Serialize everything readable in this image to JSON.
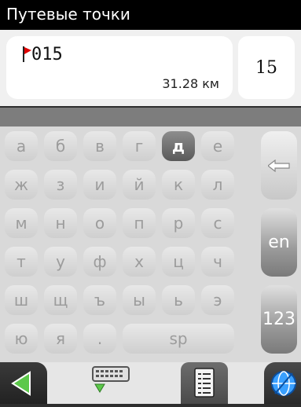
{
  "title": "Путевые точки",
  "waypoint": {
    "name": "015",
    "distance": "31.28 км",
    "flag_icon": "red-flag-icon"
  },
  "count": "15",
  "keyboard": {
    "rows": [
      [
        "а",
        "б",
        "в",
        "г",
        "д",
        "е"
      ],
      [
        "ж",
        "з",
        "и",
        "й",
        "к",
        "л"
      ],
      [
        "м",
        "н",
        "о",
        "п",
        "р",
        "с"
      ],
      [
        "т",
        "у",
        "ф",
        "х",
        "ц",
        "ч"
      ],
      [
        "ш",
        "щ",
        "ъ",
        "ы",
        "ь",
        "э"
      ],
      [
        "ю",
        "я",
        "."
      ]
    ],
    "space": "sp",
    "selected": "д",
    "backspace_icon": "backspace-arrow-icon",
    "lang": "en",
    "numbers": "123"
  },
  "bottom": {
    "back_icon": "back-arrow-icon",
    "keyboard_icon": "keyboard-icon",
    "list_icon": "list-icon",
    "map_icon": "globe-icon"
  },
  "colors": {
    "accent_green": "#5cc84a",
    "flag_red": "#e00000",
    "selected_key": "#6a6a6a"
  }
}
